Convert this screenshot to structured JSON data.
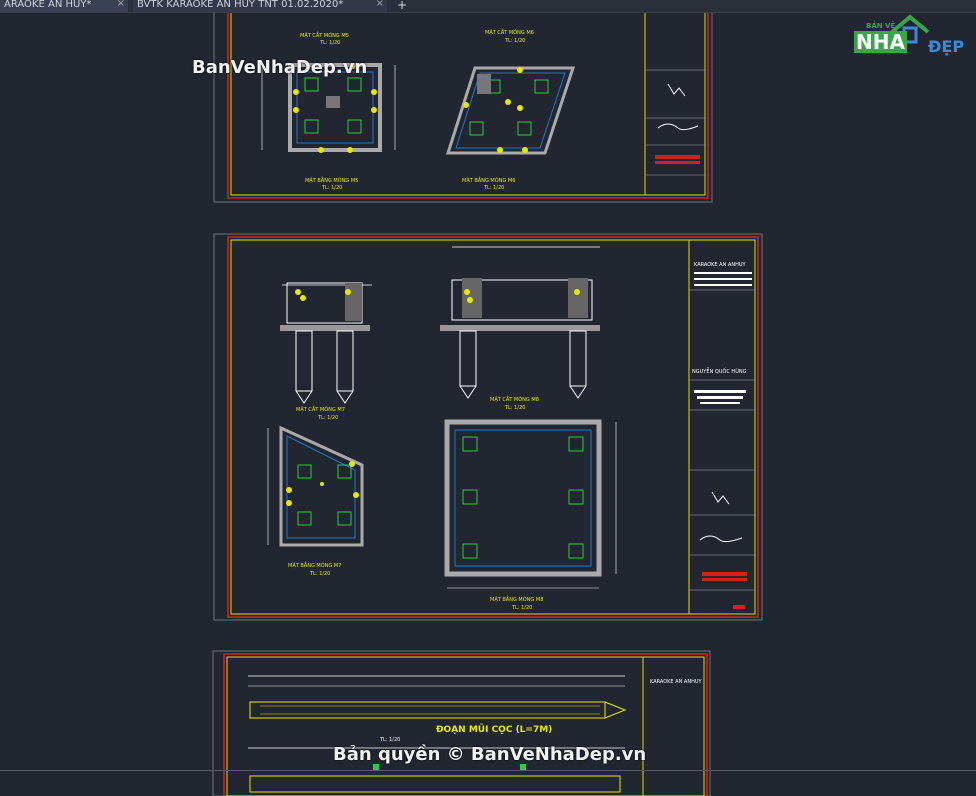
{
  "tabs": [
    {
      "label": "ARAOKE AN HUY*",
      "close": "×"
    },
    {
      "label": "BVTK KARAOKE AN HUY TNT 01.02.2020*",
      "close": "×"
    }
  ],
  "new_tab": "+",
  "watermarks": {
    "top": "BanVeNhaDep.vn",
    "bottom": "Bản quyền © BanVeNhaDep.vn"
  },
  "logo": {
    "small": "BẢN VẼ",
    "nha": "NHA",
    "dep": "ĐẸP"
  },
  "sheet1": {
    "label_a": "MẶT CẮT MÓNG M5",
    "label_b": "MẶT CẮT MÓNG M6",
    "scale_a": "TL: 1/20",
    "label_c": "MẶT BẰNG MÓNG M5",
    "label_d": "MẶT BẰNG MÓNG M6",
    "scale_c": "TL: 1/20"
  },
  "sheet2": {
    "label_a": "MẶT CẮT MÓNG M7",
    "label_b": "MẶT CẮT MÓNG M8",
    "scale_a": "TL: 1/20",
    "label_c": "MẶT BẰNG MÓNG M7",
    "label_d": "MẶT BẰNG MÓNG M8",
    "scale_c": "TL: 1/20",
    "title_owner": "KARAOKE AN ANHUY",
    "title_name": "NGUYỄN QUỐC HÙNG"
  },
  "sheet3": {
    "label_a": "ĐOẠN MŨI CỌC (L=7M)",
    "scale_a": "TL: 1/20",
    "title_owner": "KARAOKE AN ANHUY"
  }
}
